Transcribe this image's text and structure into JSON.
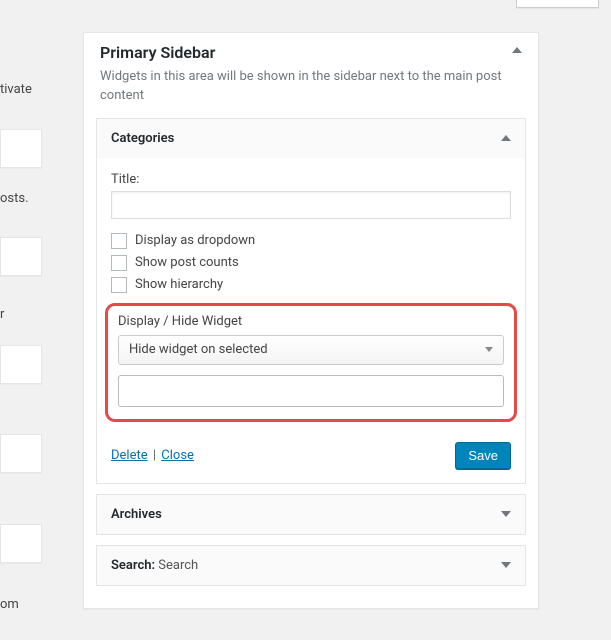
{
  "left_fragments": {
    "label1": "tivate",
    "label2": "osts.",
    "label3": "r",
    "label4": "om"
  },
  "sidebar": {
    "title": "Primary Sidebar",
    "description": "Widgets in this area will be shown in the sidebar next to the main post content"
  },
  "widgets": {
    "categories": {
      "title": "Categories",
      "title_label": "Title:",
      "title_value": "",
      "chk_dropdown": "Display as dropdown",
      "chk_counts": "Show post counts",
      "chk_hierarchy": "Show hierarchy",
      "display_hide_label": "Display / Hide Widget",
      "select_value": "Hide widget on selected",
      "delete": "Delete",
      "close": "Close",
      "save": "Save"
    },
    "archives": {
      "title": "Archives"
    },
    "search": {
      "title_prefix": "Search:",
      "title_value": "Search"
    }
  }
}
